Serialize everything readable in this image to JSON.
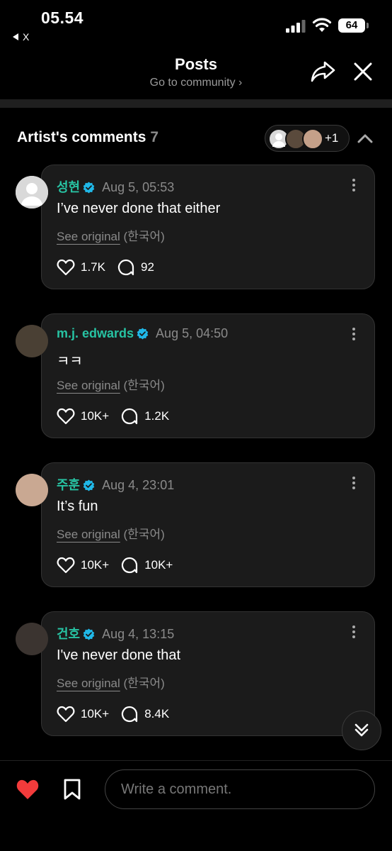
{
  "status_bar": {
    "time": "05.54",
    "back_app": "X",
    "battery": "64"
  },
  "header": {
    "title": "Posts",
    "subtitle": "Go to community ›"
  },
  "section": {
    "title": "Artist's comments",
    "count": "7",
    "more_avatars": "+1"
  },
  "comments": [
    {
      "name": "성현",
      "date": "Aug 5, 05:53",
      "text": "I’ve never done that either",
      "see_original": "See original",
      "language": "(한국어)",
      "likes": "1.7K",
      "replies": "92",
      "avatar_color": "#d9d9d9"
    },
    {
      "name": "m.j. edwards",
      "date": "Aug 5, 04:50",
      "text": "ㅋㅋ",
      "see_original": "See original",
      "language": "(한국어)",
      "likes": "10K+",
      "replies": "1.2K",
      "avatar_color": "#4a4034"
    },
    {
      "name": "주훈",
      "date": "Aug 4, 23:01",
      "text": "It’s fun",
      "see_original": "See original",
      "language": "(한국어)",
      "likes": "10K+",
      "replies": "10K+",
      "avatar_color": "#c9a892"
    },
    {
      "name": "건호",
      "date": "Aug 4, 13:15",
      "text": "I've never done that",
      "see_original": "See original",
      "language": "(한국어)",
      "likes": "10K+",
      "replies": "8.4K",
      "avatar_color": "#3b3430"
    }
  ],
  "bottom_bar": {
    "placeholder": "Write a comment."
  },
  "colors": {
    "accent": "#27c3a3",
    "verified": "#20b8e8",
    "like_active": "#f23b3b"
  }
}
